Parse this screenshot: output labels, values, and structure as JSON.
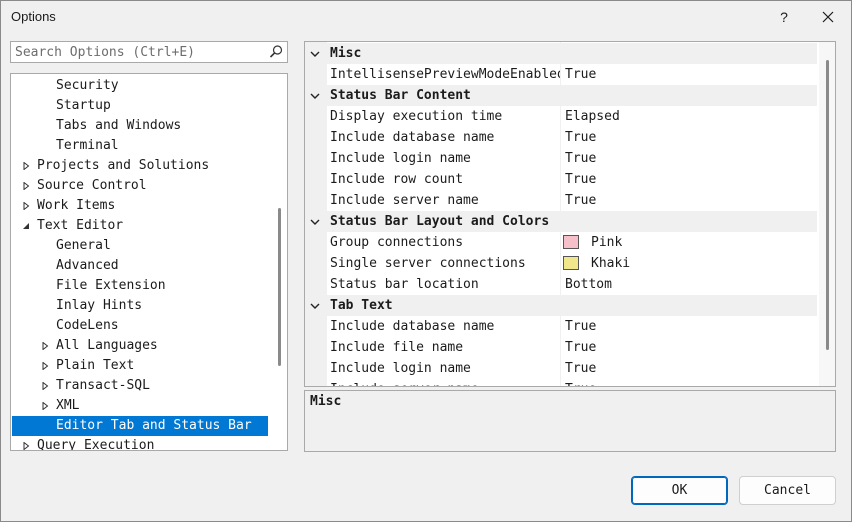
{
  "window": {
    "title": "Options",
    "help_label": "?",
    "close_label": "✕"
  },
  "search": {
    "placeholder": "Search Options (Ctrl+E)",
    "icon": "search-icon"
  },
  "tree": {
    "items": [
      {
        "label": "Security",
        "level": 2,
        "expander": "none"
      },
      {
        "label": "Startup",
        "level": 2,
        "expander": "none"
      },
      {
        "label": "Tabs and Windows",
        "level": 2,
        "expander": "none"
      },
      {
        "label": "Terminal",
        "level": 2,
        "expander": "none"
      },
      {
        "label": "Projects and Solutions",
        "level": 1,
        "expander": "collapsed"
      },
      {
        "label": "Source Control",
        "level": 1,
        "expander": "collapsed"
      },
      {
        "label": "Work Items",
        "level": 1,
        "expander": "collapsed"
      },
      {
        "label": "Text Editor",
        "level": 1,
        "expander": "expanded"
      },
      {
        "label": "General",
        "level": 2,
        "expander": "none"
      },
      {
        "label": "Advanced",
        "level": 2,
        "expander": "none"
      },
      {
        "label": "File Extension",
        "level": 2,
        "expander": "none"
      },
      {
        "label": "Inlay Hints",
        "level": 2,
        "expander": "none"
      },
      {
        "label": "CodeLens",
        "level": 2,
        "expander": "none"
      },
      {
        "label": "All Languages",
        "level": 2,
        "expander": "collapsed"
      },
      {
        "label": "Plain Text",
        "level": 2,
        "expander": "collapsed"
      },
      {
        "label": "Transact-SQL",
        "level": 2,
        "expander": "collapsed"
      },
      {
        "label": "XML",
        "level": 2,
        "expander": "collapsed"
      },
      {
        "label": "Editor Tab and Status Bar",
        "level": 2,
        "expander": "none",
        "selected": true
      },
      {
        "label": "Query Execution",
        "level": 1,
        "expander": "collapsed"
      }
    ]
  },
  "grid": {
    "rows": [
      {
        "type": "category",
        "label": "Misc"
      },
      {
        "type": "prop",
        "name": "IntellisensePreviewModeEnabled",
        "value": "True"
      },
      {
        "type": "category",
        "label": "Status Bar Content"
      },
      {
        "type": "prop",
        "name": "Display execution time",
        "value": "Elapsed"
      },
      {
        "type": "prop",
        "name": "Include database name",
        "value": "True"
      },
      {
        "type": "prop",
        "name": "Include login name",
        "value": "True"
      },
      {
        "type": "prop",
        "name": "Include row count",
        "value": "True"
      },
      {
        "type": "prop",
        "name": "Include server name",
        "value": "True"
      },
      {
        "type": "category",
        "label": "Status Bar Layout and Colors"
      },
      {
        "type": "prop",
        "name": "Group connections",
        "value": "Pink",
        "swatch": "#f6c0cb"
      },
      {
        "type": "prop",
        "name": "Single server connections",
        "value": "Khaki",
        "swatch": "#f0e68c"
      },
      {
        "type": "prop",
        "name": "Status bar location",
        "value": "Bottom"
      },
      {
        "type": "category",
        "label": "Tab Text"
      },
      {
        "type": "prop",
        "name": "Include database name",
        "value": "True"
      },
      {
        "type": "prop",
        "name": "Include file name",
        "value": "True"
      },
      {
        "type": "prop",
        "name": "Include login name",
        "value": "True"
      },
      {
        "type": "prop",
        "name": "Include server name",
        "value": "True"
      }
    ]
  },
  "description": {
    "title": "Misc"
  },
  "buttons": {
    "ok_label": "OK",
    "cancel_label": "Cancel"
  },
  "colors": {
    "selection": "#0078d4",
    "accent_border": "#0067c0"
  }
}
